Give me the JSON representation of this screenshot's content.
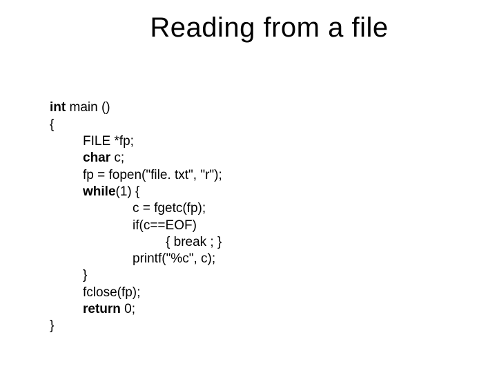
{
  "title": "Reading from a file",
  "code": {
    "kw_int": "int",
    "main_sig": " main ()",
    "open_brace": "{",
    "file_decl": "FILE *fp;",
    "kw_char": "char",
    "char_decl": " c;",
    "fopen_line": "fp = fopen(\"file. txt\", \"r\");",
    "kw_while": "while",
    "while_cond": "(1) {",
    "fgetc_line": "c = fgetc(fp);",
    "if_line": "if(c==EOF)",
    "break_line": "{ break ; }",
    "printf_line": "printf(\"%c\", c);",
    "inner_close": "}",
    "fclose_line": "fclose(fp);",
    "kw_return": "return",
    "return_val": " 0;",
    "close_brace": "}"
  }
}
